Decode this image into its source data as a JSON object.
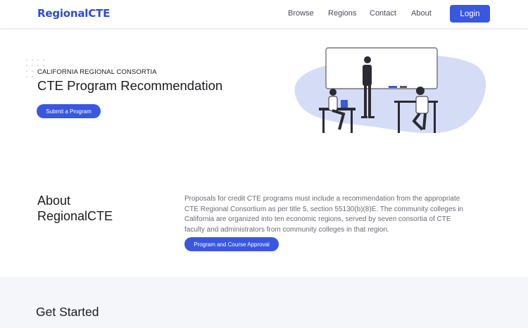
{
  "nav": {
    "brand": "RegionalCTE",
    "links": [
      "Browse",
      "Regions",
      "Contact",
      "About"
    ],
    "login_label": "Login",
    "accent_color": "#3a57e0"
  },
  "hero": {
    "eyebrow": "CALIFORNIA REGIONAL CONSORTIA",
    "title": "CTE Program Recommendation",
    "button_label": "Submit a Program"
  },
  "about": {
    "title_line1": "About",
    "title_line2": "RegionalCTE",
    "body": "Proposals for credit CTE programs must include a recommendation from the appropriate CTE Regional Consortium as per title 5, section 55130(b)(8)E. The community colleges in California are organized into ten economic regions, served by seven consortia of CTE faculty and administrators from community colleges in that region.",
    "button_label": "Program and Course Approval"
  },
  "get_started": {
    "title": "Get Started"
  }
}
